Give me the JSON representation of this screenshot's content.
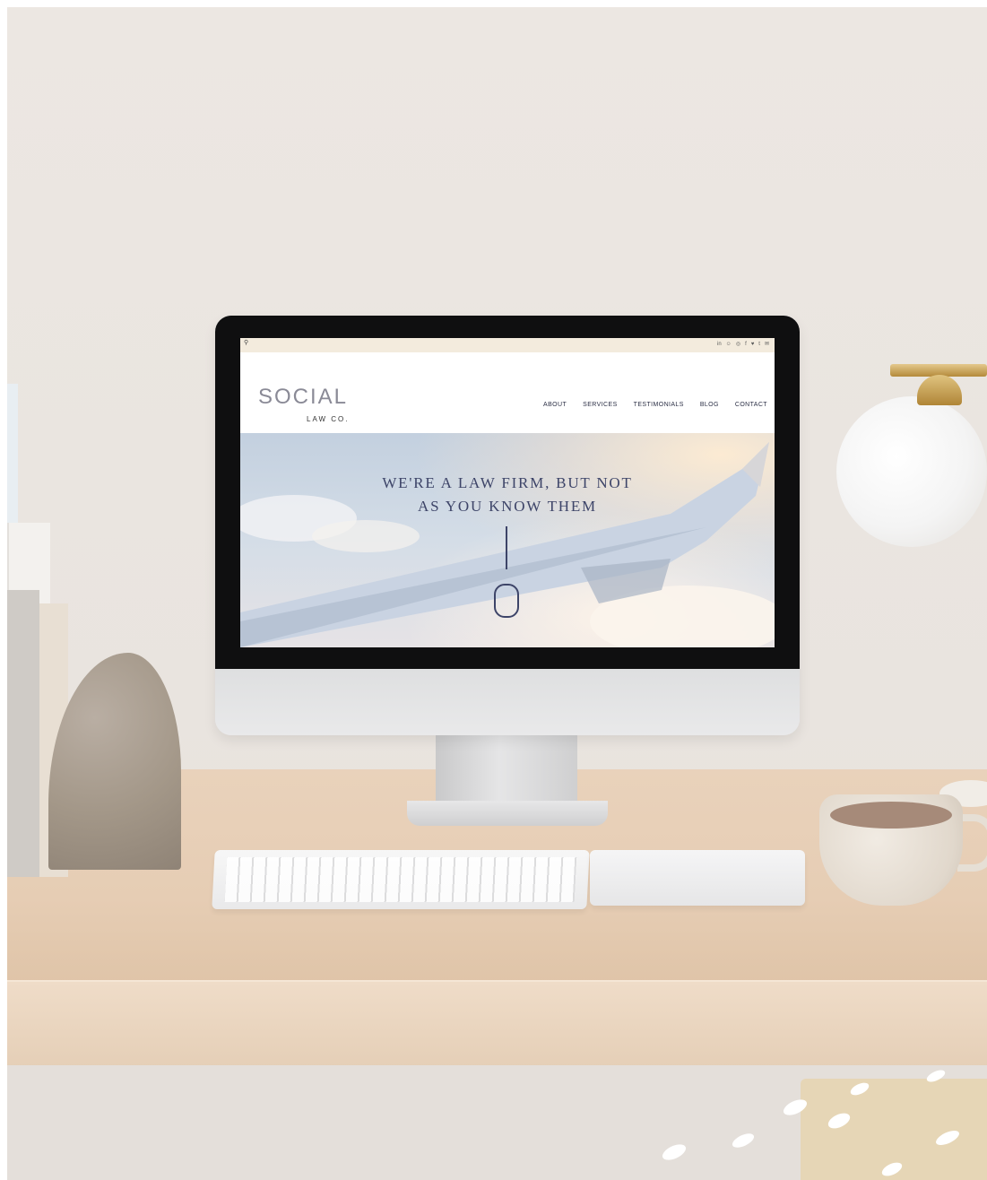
{
  "website": {
    "search_icon": "search-icon",
    "social_icons": [
      "in",
      "☺",
      "◎",
      "f",
      "♥",
      "t",
      "✉"
    ],
    "logo": {
      "main": "SOCIAL",
      "sub": "LAW CO."
    },
    "nav": [
      "ABOUT",
      "SERVICES",
      "TESTIMONIALS",
      "BLOG",
      "CONTACT"
    ],
    "hero": {
      "line1": "WE'RE A LAW FIRM, BUT NOT",
      "line2": "AS YOU KNOW THEM"
    }
  },
  "colors": {
    "navy": "#3d4468",
    "topbar": "#f3ebdd",
    "desk": "#e6cdb4"
  }
}
